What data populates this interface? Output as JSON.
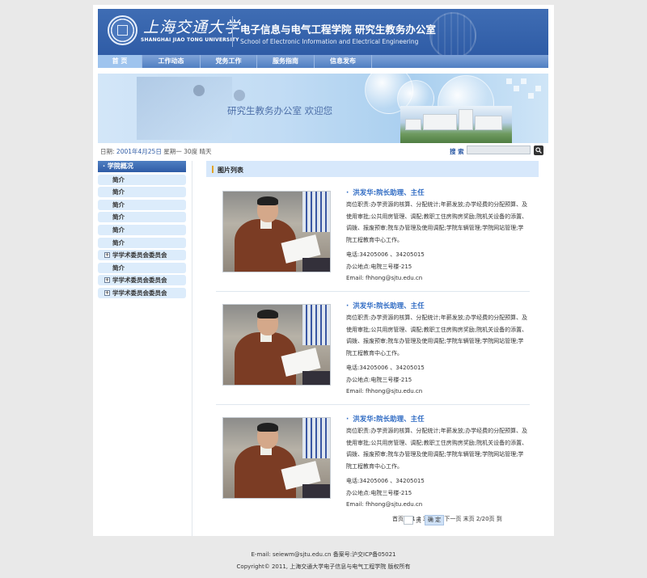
{
  "header": {
    "university_cn": "上海交通大学",
    "university_en": "SHANGHAI JIAO TONG UNIVERSITY",
    "school_cn": "电子信息与电气工程学院  研究生教务办公室",
    "school_en": "School of Electronic Information and Electrical Engineering",
    "brand_color": "#2f5ca6"
  },
  "nav": {
    "items": [
      {
        "label": "首 页"
      },
      {
        "label": "工作动态"
      },
      {
        "label": "党务工作"
      },
      {
        "label": "服务指南"
      },
      {
        "label": "信息发布"
      }
    ]
  },
  "banner": {
    "text": "研究生教务办公室   欢迎您"
  },
  "date_bar": {
    "prefix": "日期:",
    "date": "2001年4月25日",
    "suffix": "星期一 30度 晴天"
  },
  "search": {
    "label": "搜 索",
    "value": "",
    "button_icon": "search-icon"
  },
  "sidebar": {
    "heading": "· 学院概况",
    "items": [
      {
        "label": "简介"
      },
      {
        "label": "简介"
      },
      {
        "label": "简介"
      },
      {
        "label": "简介"
      },
      {
        "label": "简介"
      },
      {
        "label": "简介"
      },
      {
        "label": "学学术委员会委员会"
      },
      {
        "label": "简介"
      },
      {
        "label": "学学术委员会委员会"
      },
      {
        "label": "学学术委员会委员会"
      }
    ]
  },
  "main": {
    "title": "图片列表",
    "cards": [
      {
        "name": "洪发华:院长助理、主任",
        "duty": "岗位职责:办学资源的核算、分配统计;年薪发放;办学经费的分配预算、及使用审批;公共用房管理、调配;教职工住房购房奖励;院机关设备的添置、调拨、报废预审;院车办管理及使用调配;学院车辆管理;学院网站管理;学院工程教育中心工作。",
        "phone": "电话:34205006 、34205015",
        "office": "办公地点:电院三号楼-215",
        "email": "Email: fhhong@sjtu.edu.cn"
      },
      {
        "name": "洪发华:院长助理、主任",
        "duty": "岗位职责:办学资源的核算、分配统计;年薪发放;办学经费的分配预算、及使用审批;公共用房管理、调配;教职工住房购房奖励;院机关设备的添置、调拨、报废预审;院车办管理及使用调配;学院车辆管理;学院网站管理;学院工程教育中心工作。",
        "phone": "电话:34205006 、34205015",
        "office": "办公地点:电院三号楼-215",
        "email": "Email: fhhong@sjtu.edu.cn"
      },
      {
        "name": "洪发华:院长助理、主任",
        "duty": "岗位职责:办学资源的核算、分配统计;年薪发放;办学经费的分配预算、及使用审批;公共用房管理、调配;教职工住房购房奖励;院机关设备的添置、调拨、报废预审;院车办管理及使用调配;学院车辆管理;学院网站管理;学院工程教育中心工作。",
        "phone": "电话:34205006 、34205015",
        "office": "办公地点:电院三号楼-215",
        "email": "Email: fhhong@sjtu.edu.cn"
      }
    ]
  },
  "pager": {
    "text": "首页 < 1 2 3 4 5 ...下一页 末页 2/20页 到",
    "unit": "页",
    "button": "确 定"
  },
  "footer": {
    "line1": "E-mail: seiewm@sjtu.edu.cn 备案号:沪交ICP备05021",
    "line2": "Copyright© 2011, 上海交通大学电子信息与电气工程学院 版权所有"
  }
}
